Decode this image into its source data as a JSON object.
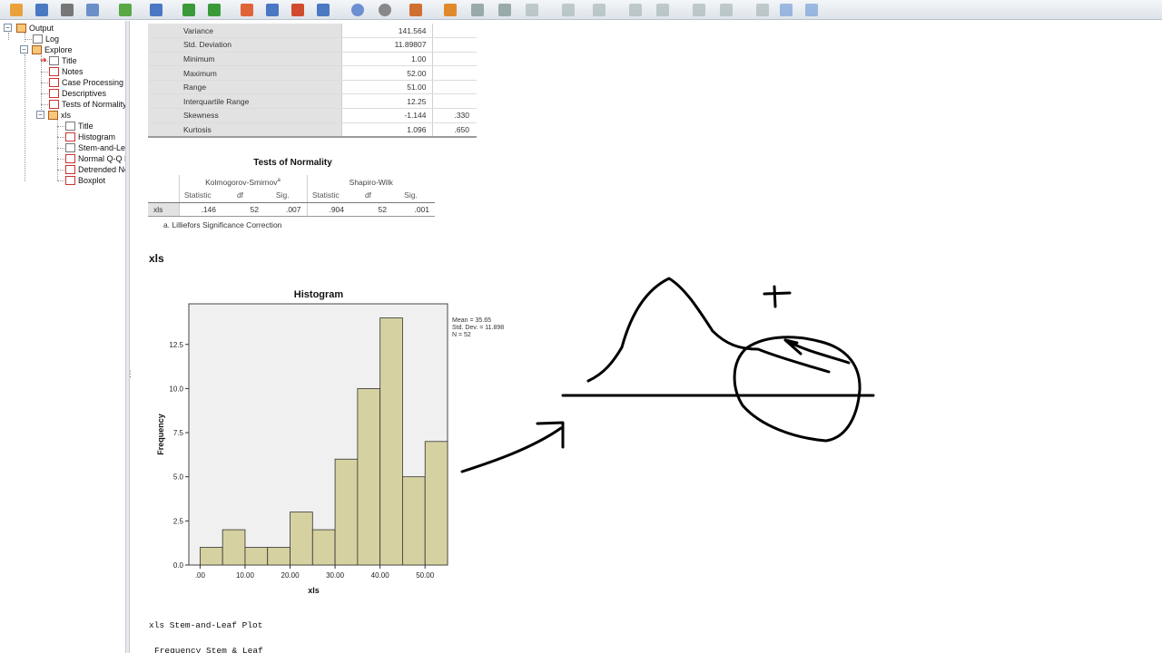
{
  "toolbar": {
    "icons": [
      "open-icon",
      "save-icon",
      "print-icon",
      "print-preview-icon",
      "export-icon",
      "recall-dialog-icon",
      "undo-icon",
      "redo-icon",
      "goto-data-icon",
      "goto-case-icon",
      "goto-variable-icon",
      "variables-icon",
      "designate-window-icon",
      "select-last-output-icon",
      "select-cases-icon",
      "weight-cases-icon",
      "split-file-icon",
      "value-labels-icon",
      "use-sets-icon",
      "show-all-variables-icon",
      "promote-icon",
      "demote-icon",
      "expand-icon",
      "collapse-icon",
      "show-icon",
      "hide-icon",
      "insert-heading-icon",
      "insert-title-icon",
      "insert-text-icon"
    ]
  },
  "tree": {
    "output": "Output",
    "log": "Log",
    "explore": "Explore",
    "title": "Title",
    "notes": "Notes",
    "case_processing": "Case Processing",
    "descriptives": "Descriptives",
    "tests_of_normality": "Tests of Normality",
    "xls": "xls",
    "xls_title": "Title",
    "histogram": "Histogram",
    "stem_and_leaf": "Stem-and-Le",
    "normal_qq": "Normal Q-Q P",
    "detrended": "Detrended No",
    "boxplot": "Boxplot"
  },
  "descriptives": {
    "rows": [
      {
        "label": "Variance",
        "statistic": "141.564",
        "std_error": ""
      },
      {
        "label": "Std. Deviation",
        "statistic": "11.89807",
        "std_error": ""
      },
      {
        "label": "Minimum",
        "statistic": "1.00",
        "std_error": ""
      },
      {
        "label": "Maximum",
        "statistic": "52.00",
        "std_error": ""
      },
      {
        "label": "Range",
        "statistic": "51.00",
        "std_error": ""
      },
      {
        "label": "Interquartile Range",
        "statistic": "12.25",
        "std_error": ""
      },
      {
        "label": "Skewness",
        "statistic": "-1.144",
        "std_error": ".330"
      },
      {
        "label": "Kurtosis",
        "statistic": "1.096",
        "std_error": ".650"
      }
    ]
  },
  "normality": {
    "title": "Tests of Normality",
    "ks_label": "Kolmogorov-Smirnov",
    "ks_sup": "a",
    "sw_label": "Shapiro-Wilk",
    "headers": [
      "Statistic",
      "df",
      "Sig.",
      "Statistic",
      "df",
      "Sig."
    ],
    "row_label": "xls",
    "values": [
      ".146",
      "52",
      ".007",
      ".904",
      "52",
      ".001"
    ],
    "footnote": "a. Lilliefors Significance Correction"
  },
  "section_heading": "xls",
  "stats": {
    "mean": "Mean = 35.65",
    "sd": "Std. Dev. = 11.898",
    "n": "N = 52"
  },
  "chart_data": {
    "type": "bar",
    "title": "Histogram",
    "xlabel": "xls",
    "ylabel": "Frequency",
    "bin_width": 5,
    "bin_starts": [
      0,
      5,
      10,
      15,
      20,
      25,
      30,
      35,
      40,
      45,
      50
    ],
    "values": [
      1,
      2,
      1,
      1,
      3,
      2,
      6,
      10,
      14,
      5,
      7
    ],
    "x_ticks": [
      ".00",
      "10.00",
      "20.00",
      "30.00",
      "40.00",
      "50.00"
    ],
    "x_tick_values": [
      0,
      10,
      20,
      30,
      40,
      50
    ],
    "y_ticks": [
      "0.0",
      "2.5",
      "5.0",
      "7.5",
      "10.0",
      "12.5"
    ],
    "y_tick_values": [
      0,
      2.5,
      5,
      7.5,
      10,
      12.5
    ],
    "xlim": [
      -2.5,
      55
    ],
    "ylim": [
      0,
      14.8
    ],
    "bar_color": "#d6d1a0",
    "plot_bg": "#f0f0f0"
  },
  "stem_leaf": {
    "title": "xls Stem-and-Leaf Plot",
    "header": "Frequency    Stem &  Leaf"
  },
  "ink_color": "#000000"
}
